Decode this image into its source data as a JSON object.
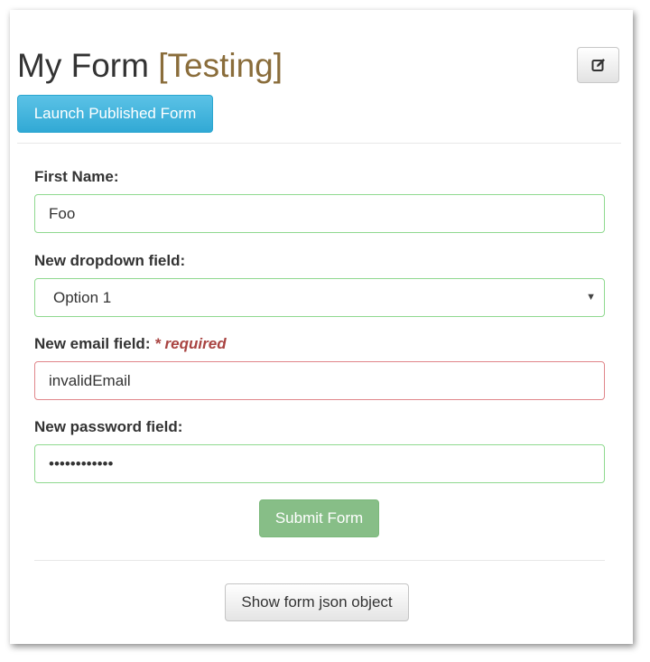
{
  "header": {
    "title": "My Form",
    "tag": "[Testing]",
    "edit_icon": "edit-icon",
    "launch_label": "Launch Published Form"
  },
  "form": {
    "first_name": {
      "label": "First Name:",
      "value": "Foo"
    },
    "dropdown": {
      "label": "New dropdown field:",
      "selected": "Option 1"
    },
    "email": {
      "label": "New email field:",
      "required_text": "* required",
      "value": "invalidEmail"
    },
    "password": {
      "label": "New password field:",
      "masked_value": "••••••••••••"
    },
    "submit_label": "Submit Form"
  },
  "footer": {
    "json_button_label": "Show form json object"
  },
  "colors": {
    "tag": "#8a6d3b",
    "valid_border": "#8fd98f",
    "error_border": "#e0868a",
    "required_text": "#a94442",
    "launch_button": "#31a9d5",
    "submit_button": "#87be87"
  }
}
